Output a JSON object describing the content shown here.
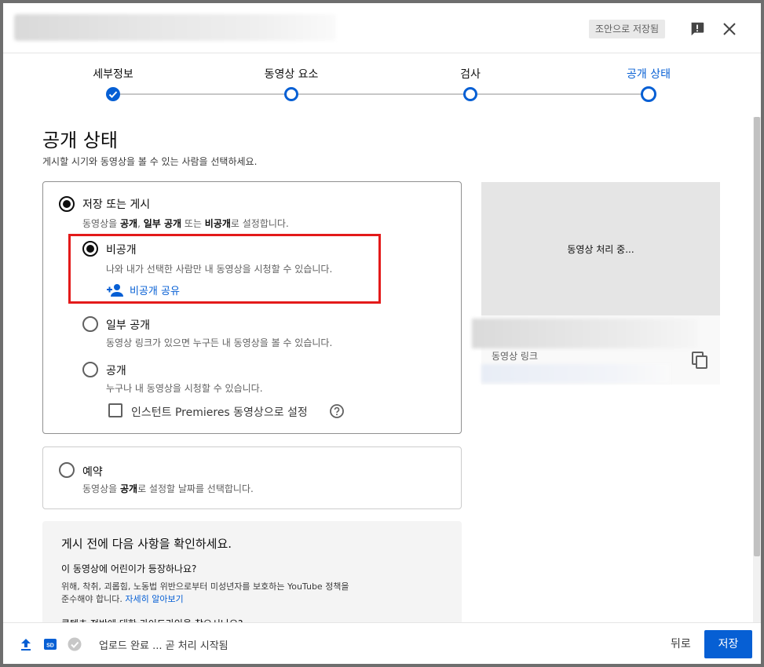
{
  "header": {
    "draft_label": "조안으로 저장됨"
  },
  "stepper": {
    "steps": [
      {
        "label": "세부정보",
        "state": "done"
      },
      {
        "label": "동영상 요소",
        "state": "open"
      },
      {
        "label": "검사",
        "state": "open"
      },
      {
        "label": "공개 상태",
        "state": "current"
      }
    ]
  },
  "visibility": {
    "title": "공개 상태",
    "subtitle": "게시할 시기와 동영상을 볼 수 있는 사람을 선택하세요.",
    "save_or_publish": {
      "title": "저장 또는 게시",
      "desc_prefix": "동영상을 ",
      "desc_b1": "공개",
      "desc_sep": ", ",
      "desc_b2": "일부 공개",
      "desc_mid": " 또는 ",
      "desc_b3": "비공개",
      "desc_suffix": "로 설정합니다."
    },
    "options": {
      "private": {
        "title": "비공개",
        "desc": "나와 내가 선택한 사람만 내 동영상을 시청할 수 있습니다.",
        "share_label": "비공개 공유",
        "selected": true
      },
      "unlisted": {
        "title": "일부 공개",
        "desc": "동영상 링크가 있으면 누구든 내 동영상을 볼 수 있습니다."
      },
      "public": {
        "title": "공개",
        "desc": "누구나 내 동영상을 시청할 수 있습니다.",
        "premiere_label": "인스턴트 Premieres 동영상으로 설정"
      }
    },
    "schedule": {
      "title": "예약",
      "desc_prefix": "동영상을 ",
      "desc_b": "공개",
      "desc_suffix": "로 설정할 날짜를 선택합니다."
    }
  },
  "preview": {
    "processing": "동영상 처리 중...",
    "link_label": "동영상 링크"
  },
  "checklist": {
    "title": "게시 전에 다음 사항을 확인하세요.",
    "q1": "이 동영상에 어린이가 등장하나요?",
    "body_line1": "위해, 착취, 괴롭힘, 노동법 위반으로부터 미성년자를 보호하는 YouTube 정책을",
    "body_line2": "준수해야 합니다. ",
    "learn_more": "자세히 알아보기",
    "q2": "콘텐츠 전반에 대한 가이드라인을 찾으시나요?"
  },
  "footer": {
    "status": "업로드 완료 ... 곧 처리 시작됨",
    "back_label": "뒤로",
    "save_label": "저장"
  },
  "colors": {
    "accent": "#065fd4",
    "highlight": "#e31a1a"
  }
}
